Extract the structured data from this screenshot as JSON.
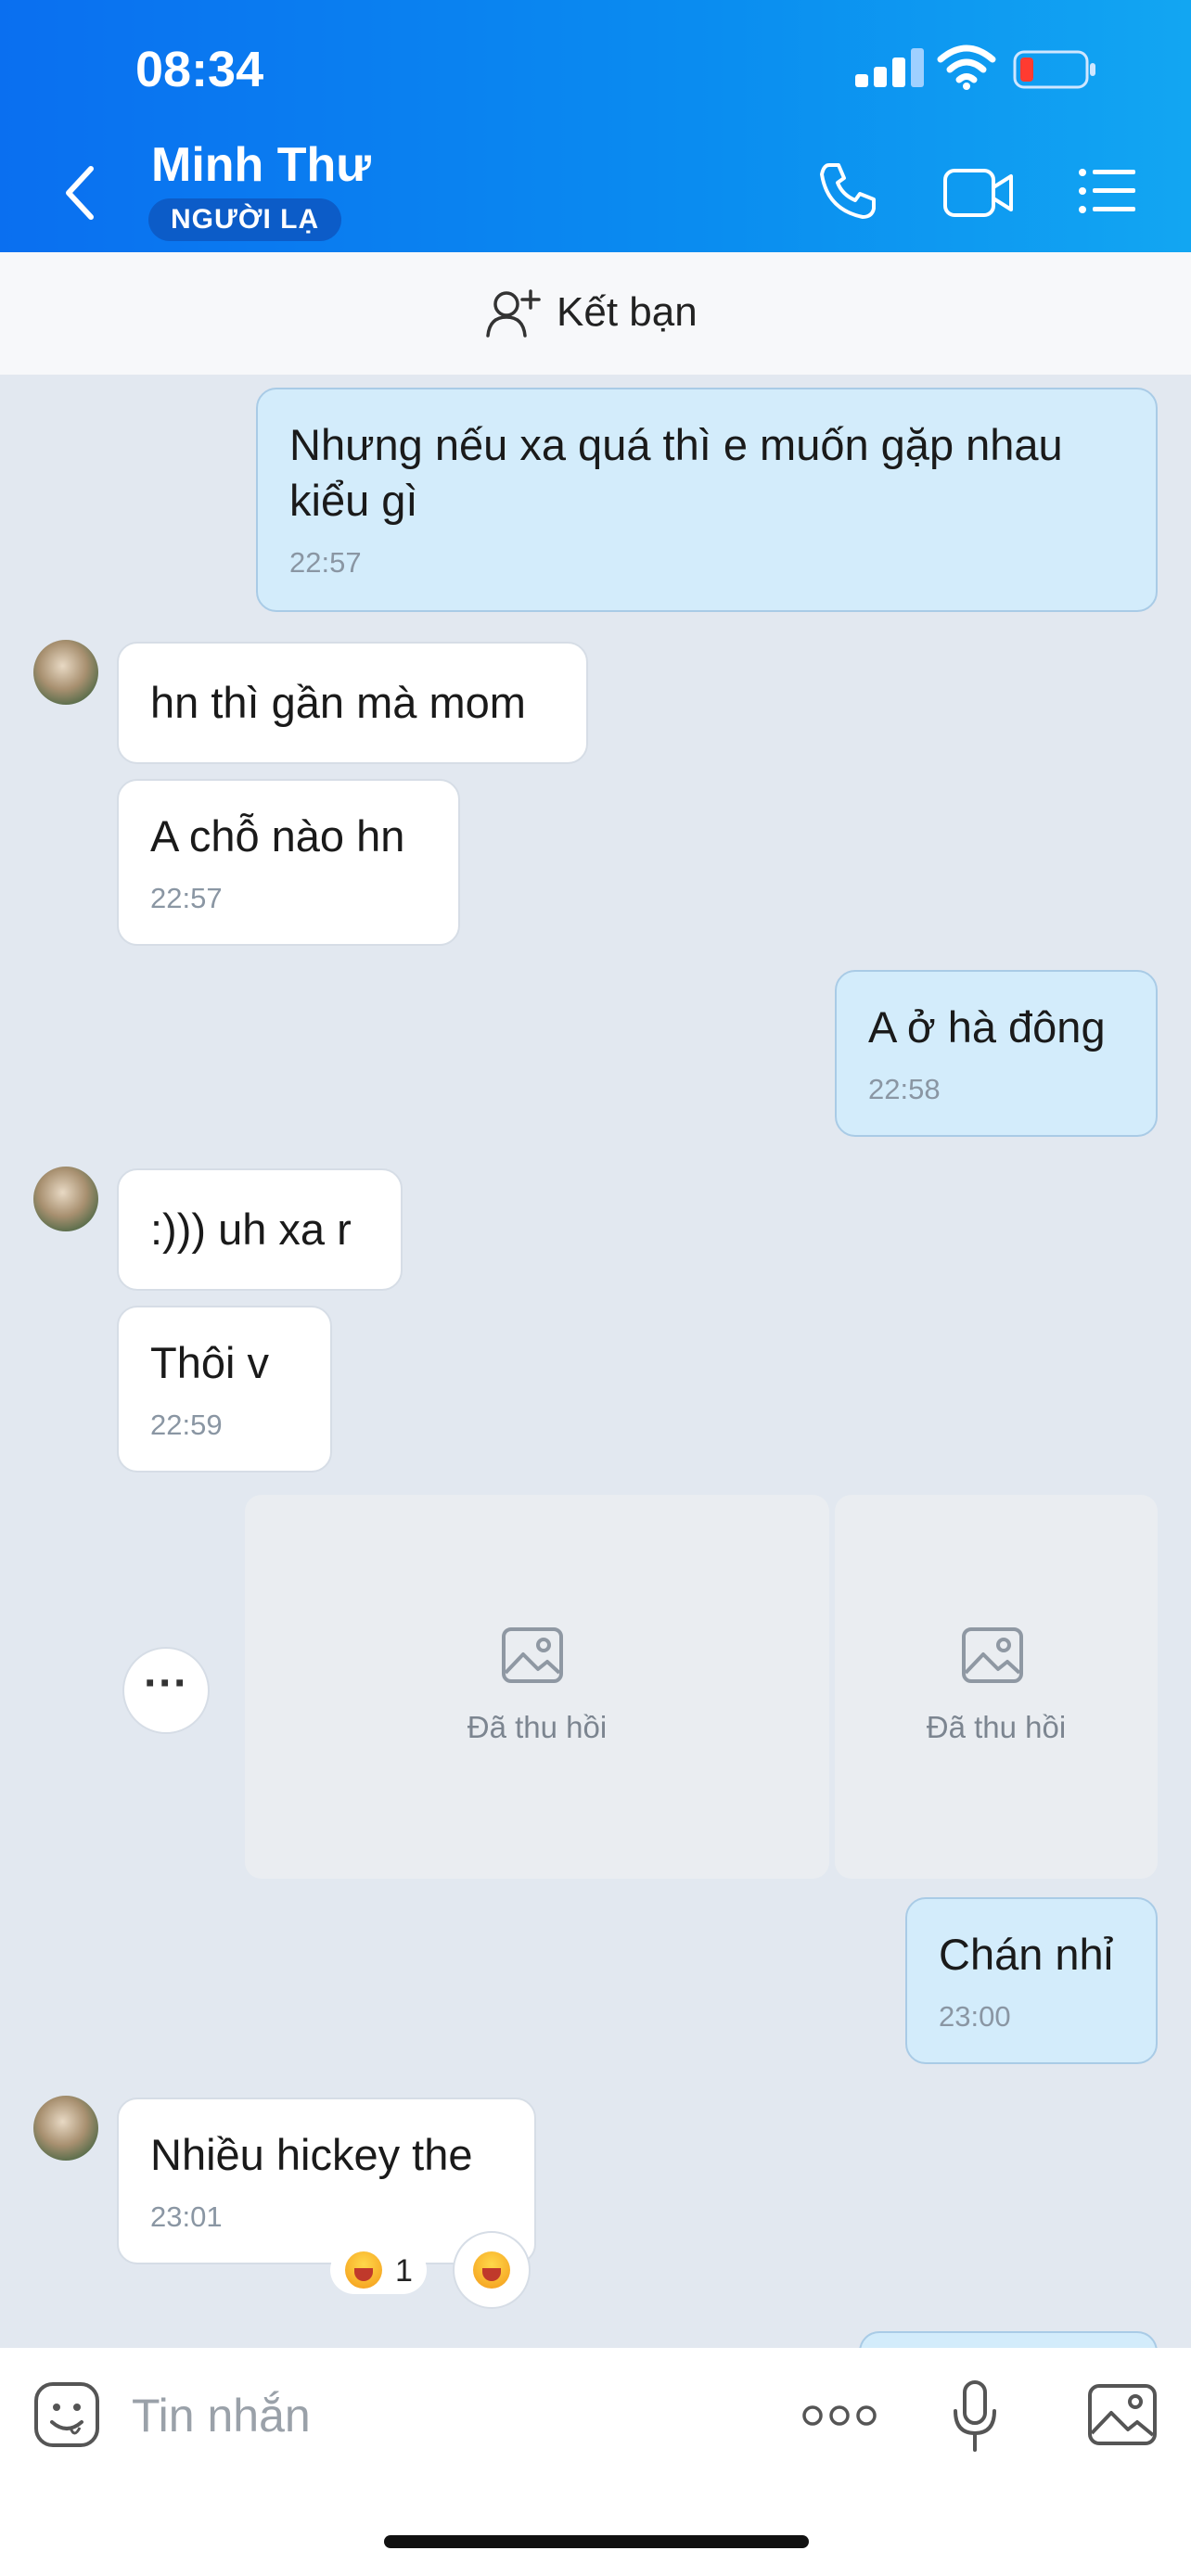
{
  "status_bar": {
    "time": "08:34"
  },
  "header": {
    "contact_name": "Minh Thư",
    "badge": "NGƯỜI LẠ"
  },
  "friend_bar": {
    "label": "Kết bạn"
  },
  "messages": [
    {
      "side": "out",
      "text": "Nhưng nếu xa quá thì e muốn gặp nhau kiểu gì",
      "time": "22:57"
    },
    {
      "side": "in",
      "text": "hn thì gần mà mom"
    },
    {
      "side": "in",
      "text": "A chỗ nào hn",
      "time": "22:57"
    },
    {
      "side": "out",
      "text": "A ở hà đông",
      "time": "22:58"
    },
    {
      "side": "in",
      "text": ":))) uh xa r"
    },
    {
      "side": "in",
      "text": "Thôi v",
      "time": "22:59"
    },
    {
      "side": "out",
      "text": "Chán nhỉ",
      "time": "23:00"
    },
    {
      "side": "in",
      "text": "Nhiều hickey the",
      "time": "23:01"
    }
  ],
  "recalled_images": [
    {
      "label": "Đã thu hồi"
    },
    {
      "label": "Đã thu hồi"
    }
  ],
  "reaction": {
    "count": "1"
  },
  "input": {
    "placeholder": "Tin nhắn"
  },
  "colors": {
    "header_blue": "#0a8df0",
    "outgoing_bubble": "#d3ecfb",
    "chat_background": "#e2e8f0"
  }
}
